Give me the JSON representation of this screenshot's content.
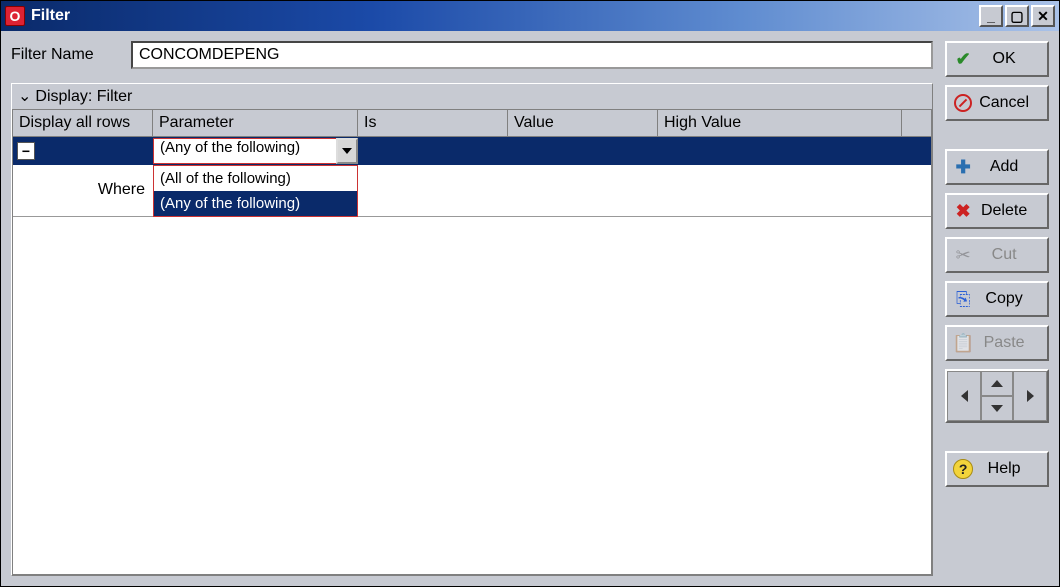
{
  "window": {
    "title": "Filter"
  },
  "filterName": {
    "label": "Filter Name",
    "value": "CONCOMDEPENG"
  },
  "panel": {
    "title": "Display: Filter"
  },
  "columns": {
    "c1": "Display all rows",
    "c2": "Parameter",
    "c3": "Is",
    "c4": "Value",
    "c5": "High Value"
  },
  "row1": {
    "combo_value": "(Any of the following)"
  },
  "row2": {
    "label": "Where"
  },
  "dropdown": {
    "opt1": "(All of the following)",
    "opt2": "(Any of the following)"
  },
  "buttons": {
    "ok": "OK",
    "cancel": "Cancel",
    "add": "Add",
    "delete": "Delete",
    "cut": "Cut",
    "copy": "Copy",
    "paste": "Paste",
    "help": "Help"
  }
}
